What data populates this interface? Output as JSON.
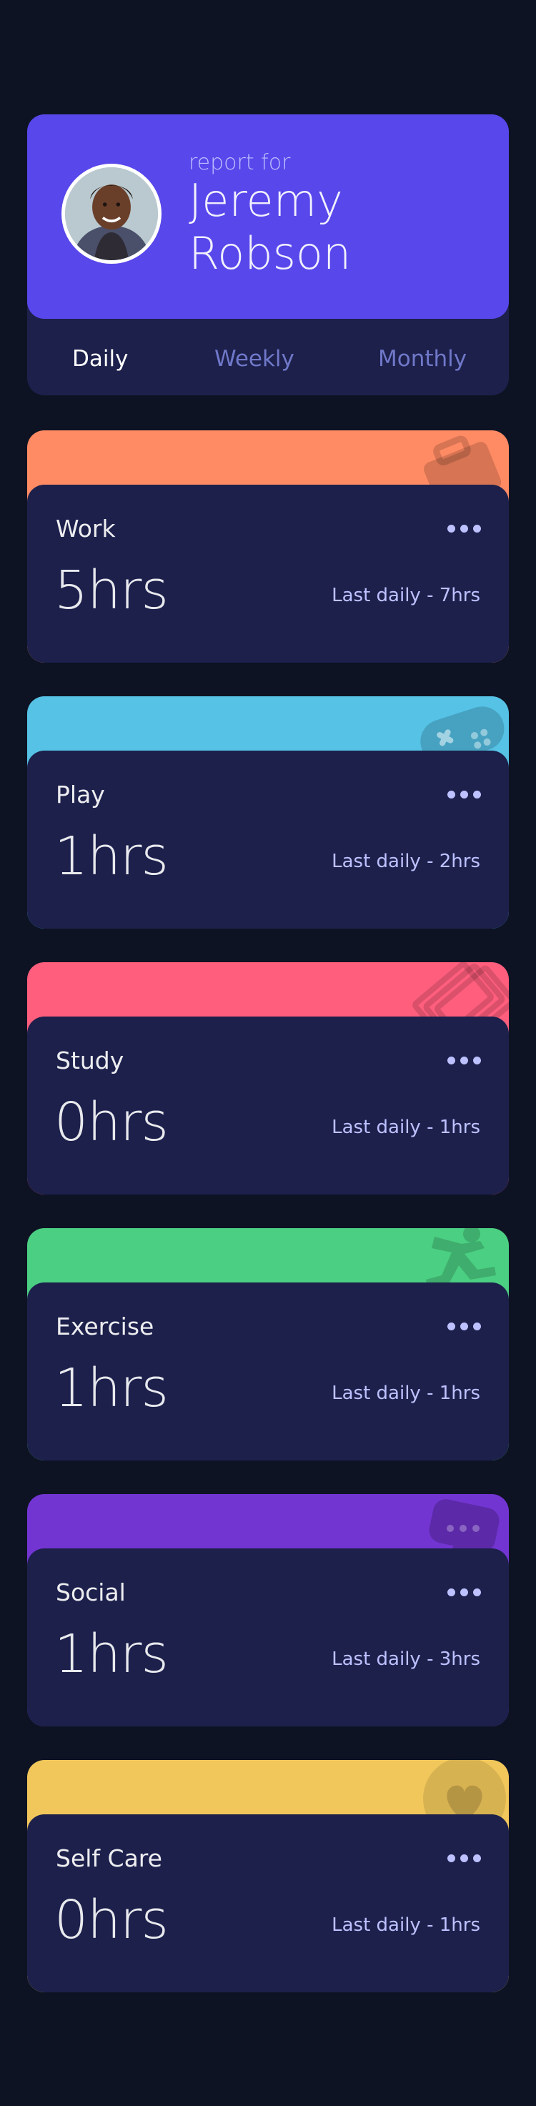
{
  "profile": {
    "report_for": "report for",
    "first_name": "Jeremy",
    "last_name": "Robson"
  },
  "tabs": [
    {
      "label": "Daily",
      "active": true
    },
    {
      "label": "Weekly",
      "active": false
    },
    {
      "label": "Monthly",
      "active": false
    }
  ],
  "activities": [
    {
      "title": "Work",
      "hours": "5hrs",
      "previous": "Last daily - 7hrs",
      "color": "#ff8b64",
      "icon": "briefcase-icon"
    },
    {
      "title": "Play",
      "hours": "1hrs",
      "previous": "Last daily - 2hrs",
      "color": "#55c2e6",
      "icon": "gamepad-icon"
    },
    {
      "title": "Study",
      "hours": "0hrs",
      "previous": "Last daily - 1hrs",
      "color": "#ff5e7d",
      "icon": "books-icon"
    },
    {
      "title": "Exercise",
      "hours": "1hrs",
      "previous": "Last daily - 1hrs",
      "color": "#4bcf82",
      "icon": "running-icon"
    },
    {
      "title": "Social",
      "hours": "1hrs",
      "previous": "Last daily - 3hrs",
      "color": "#7335d2",
      "icon": "chat-icon"
    },
    {
      "title": "Self Care",
      "hours": "0hrs",
      "previous": "Last daily - 1hrs",
      "color": "#f1c75b",
      "icon": "heart-icon"
    }
  ],
  "colors": {
    "background": "#0e1323",
    "card": "#1c204b",
    "accent": "#5847eb",
    "muted": "#bdc1ff"
  }
}
